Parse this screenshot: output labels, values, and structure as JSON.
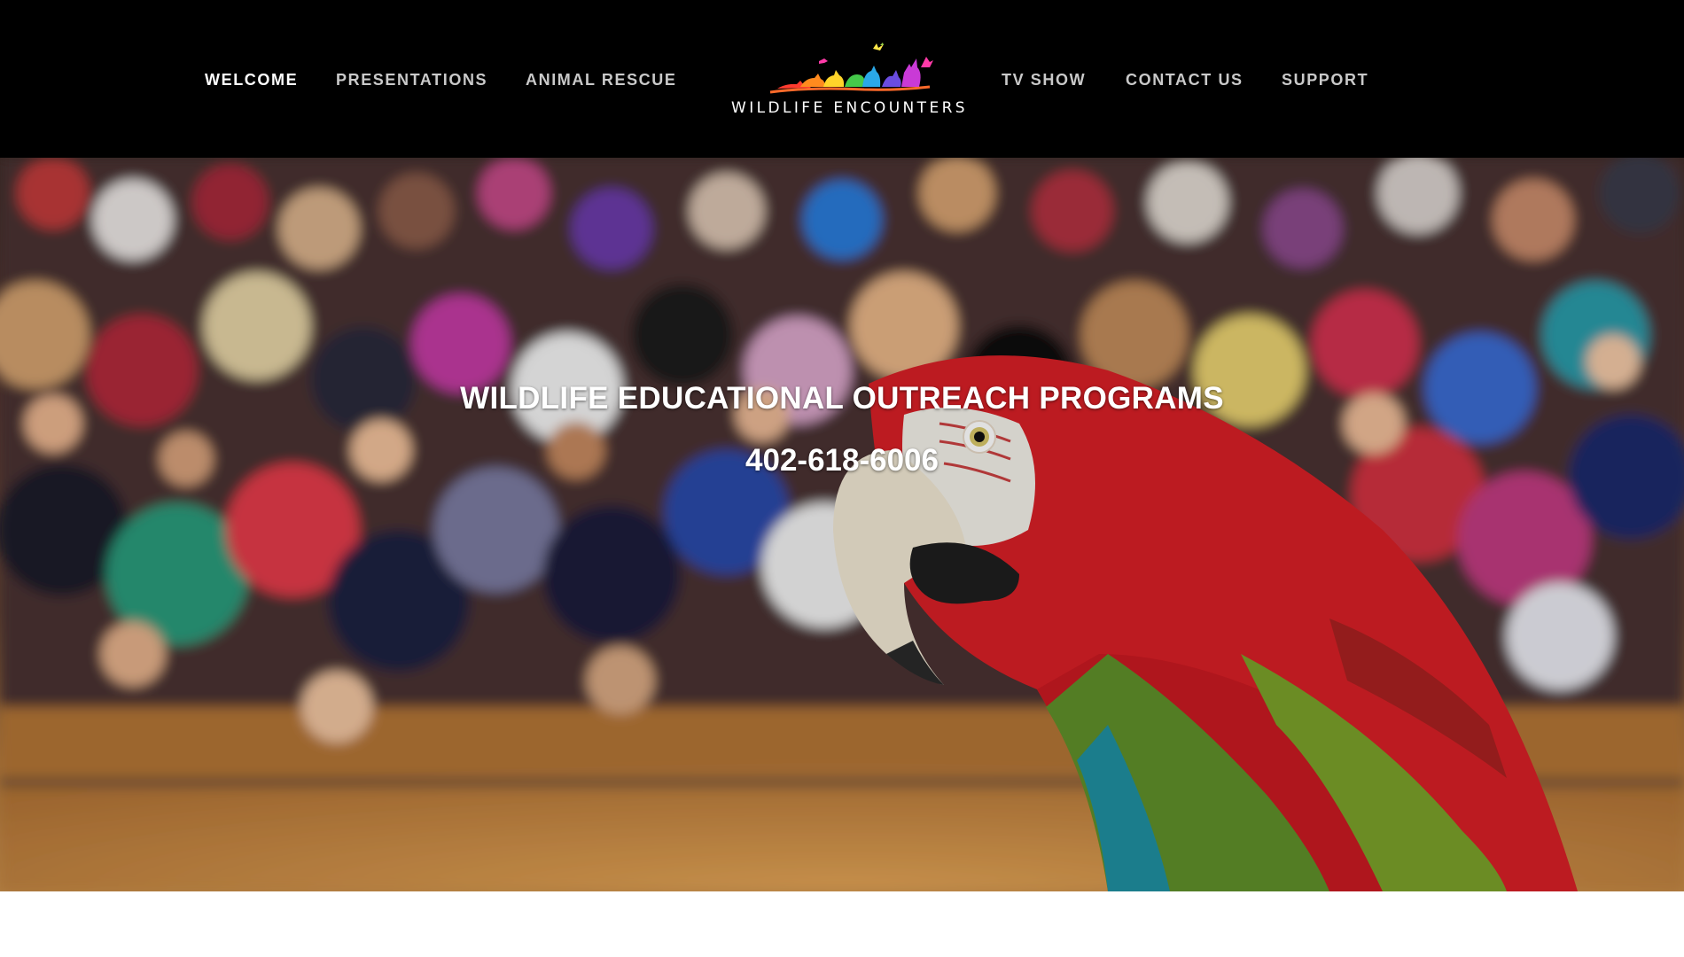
{
  "nav": {
    "left": [
      {
        "label": "WELCOME",
        "active": true
      },
      {
        "label": "PRESENTATIONS",
        "active": false
      },
      {
        "label": "ANIMAL RESCUE",
        "active": false
      }
    ],
    "right": [
      {
        "label": "TV SHOW",
        "active": false
      },
      {
        "label": "CONTACT US",
        "active": false
      },
      {
        "label": "SUPPORT",
        "active": false
      }
    ]
  },
  "logo": {
    "text": "WILDLIFE ENCOUNTERS",
    "icon": "rainbow-animal-silhouettes-icon"
  },
  "hero": {
    "title": "WILDLIFE EDUCATIONAL OUTREACH PROGRAMS",
    "phone": "402-618-6006",
    "image": "macaw-in-front-of-seated-children-photo"
  },
  "colors": {
    "header_bg": "#000000",
    "nav_text": "#c9c9c9",
    "nav_active": "#ffffff",
    "hero_text": "#ffffff",
    "page_bg": "#ffffff"
  }
}
